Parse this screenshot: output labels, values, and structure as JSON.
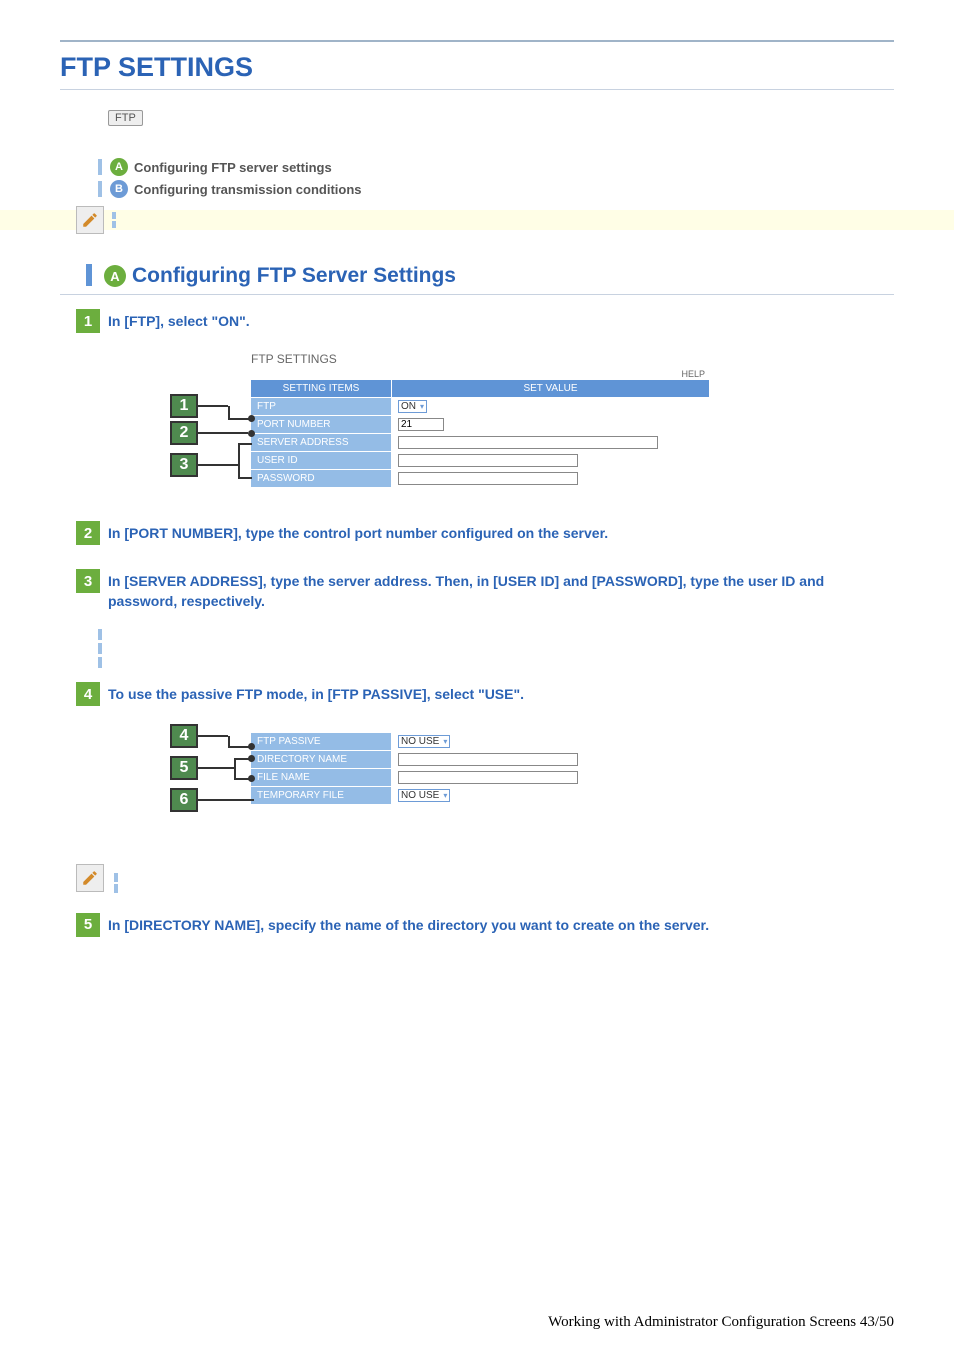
{
  "page_title": "FTP SETTINGS",
  "ftp_chip": "FTP",
  "toc": [
    {
      "letter": "A",
      "letter_class": "letter-a",
      "label": "Configuring FTP server settings"
    },
    {
      "letter": "B",
      "letter_class": "letter-b",
      "label": "Configuring transmission conditions"
    }
  ],
  "section_a": {
    "letter": "A",
    "title": "Configuring FTP Server Settings"
  },
  "steps": {
    "s1": {
      "num": "1",
      "text": "In [FTP], select \"ON\"."
    },
    "s2": {
      "num": "2",
      "text": "In [PORT NUMBER], type the control port number configured on the server."
    },
    "s3": {
      "num": "3",
      "text": "In [SERVER ADDRESS], type the server address. Then, in [USER ID] and [PASSWORD], type the user ID and password, respectively."
    },
    "s4": {
      "num": "4",
      "text": "To use the passive FTP mode, in [FTP PASSIVE], select \"USE\"."
    },
    "s5": {
      "num": "5",
      "text": "In [DIRECTORY NAME], specify the name of the directory you want to create on the server."
    }
  },
  "table1": {
    "title": "FTP SETTINGS",
    "help": "HELP",
    "h1": "SETTING ITEMS",
    "h2": "SET VALUE",
    "r1": {
      "label": "FTP",
      "value": "ON"
    },
    "r2": {
      "label": "PORT NUMBER",
      "value": "21"
    },
    "r3": {
      "label": "SERVER ADDRESS"
    },
    "r4": {
      "label": "USER ID"
    },
    "r5": {
      "label": "PASSWORD"
    },
    "callouts": {
      "c1": "1",
      "c2": "2",
      "c3": "3"
    }
  },
  "table2": {
    "r1": {
      "label": "FTP PASSIVE",
      "value": "NO USE"
    },
    "r2": {
      "label": "DIRECTORY NAME"
    },
    "r3": {
      "label": "FILE NAME"
    },
    "r4": {
      "label": "TEMPORARY FILE",
      "value": "NO USE"
    },
    "callouts": {
      "c4": "4",
      "c5": "5",
      "c6": "6"
    }
  },
  "footer": "Working with Administrator Configuration Screens 43/50"
}
